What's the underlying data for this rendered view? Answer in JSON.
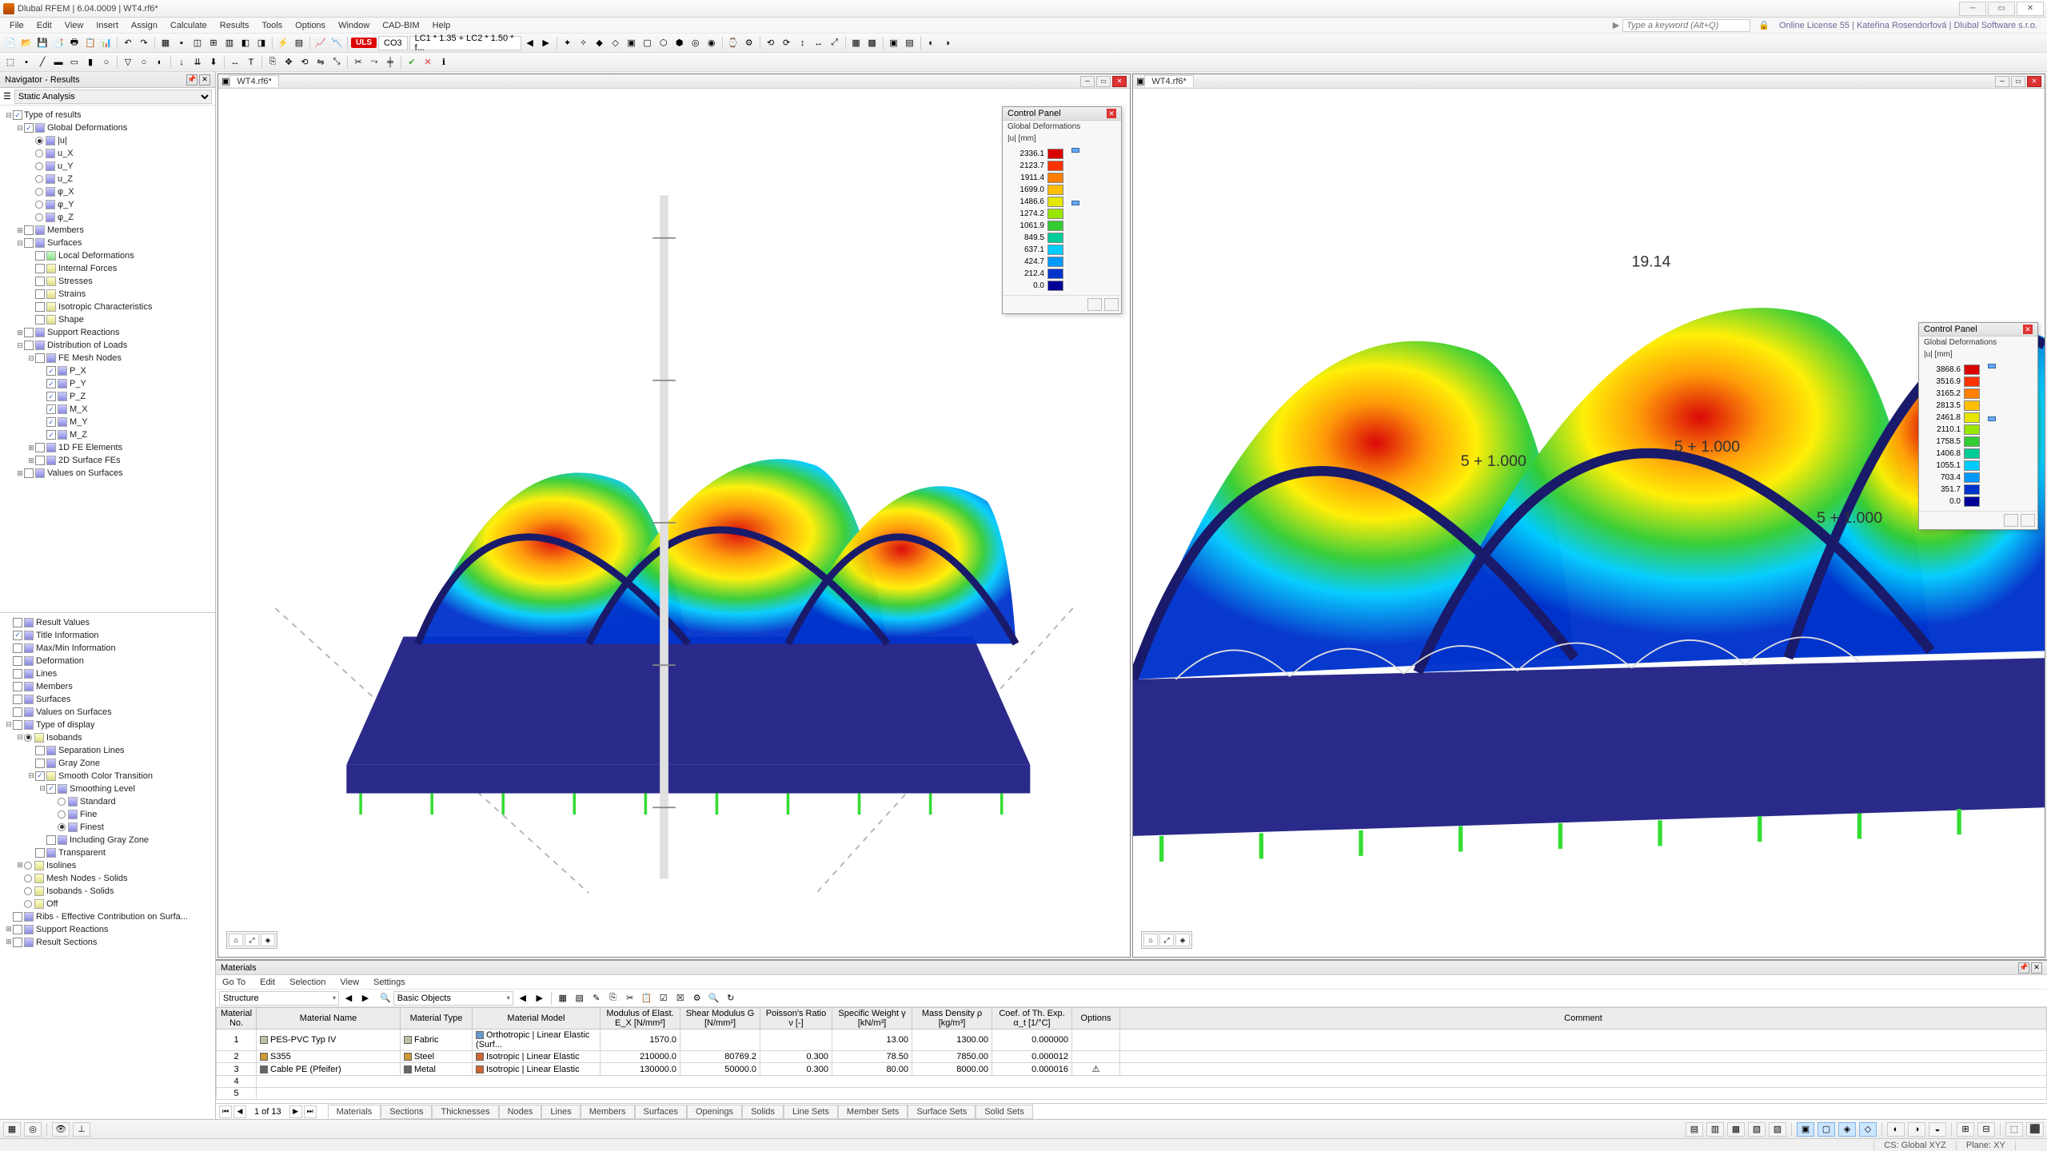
{
  "app": {
    "title": "Dlubal RFEM | 6.04.0009 | WT4.rf6*",
    "keyword_placeholder": "Type a keyword (Alt+Q)",
    "license": "Online License 55 | Kateřina Rosendorfová | Dlubal Software s.r.o."
  },
  "menu": [
    "File",
    "Edit",
    "View",
    "Insert",
    "Assign",
    "Calculate",
    "Results",
    "Tools",
    "Options",
    "Window",
    "CAD-BIM",
    "Help"
  ],
  "loadcase": {
    "badge": "ULS",
    "combo": "CO3",
    "desc": "LC1 * 1.35 + LC2 * 1.50 * f..."
  },
  "navigator": {
    "title": "Navigator - Results",
    "mode": "Static Analysis",
    "top": [
      {
        "lvl": 0,
        "toggle": "-",
        "cb": true,
        "label": "Type of results"
      },
      {
        "lvl": 1,
        "toggle": "-",
        "cb": true,
        "ico": "b",
        "label": "Global Deformations"
      },
      {
        "lvl": 2,
        "radio": true,
        "on": true,
        "ico": "b",
        "label": "|u|"
      },
      {
        "lvl": 2,
        "radio": true,
        "ico": "b",
        "label": "u_X"
      },
      {
        "lvl": 2,
        "radio": true,
        "ico": "b",
        "label": "u_Y"
      },
      {
        "lvl": 2,
        "radio": true,
        "ico": "b",
        "label": "u_Z"
      },
      {
        "lvl": 2,
        "radio": true,
        "ico": "b",
        "label": "φ_X"
      },
      {
        "lvl": 2,
        "radio": true,
        "ico": "b",
        "label": "φ_Y"
      },
      {
        "lvl": 2,
        "radio": true,
        "ico": "b",
        "label": "φ_Z"
      },
      {
        "lvl": 1,
        "toggle": "+",
        "cb": false,
        "ico": "b",
        "label": "Members"
      },
      {
        "lvl": 1,
        "toggle": "-",
        "cb": false,
        "ico": "b",
        "label": "Surfaces"
      },
      {
        "lvl": 2,
        "cb": false,
        "ico": "g",
        "label": "Local Deformations"
      },
      {
        "lvl": 2,
        "cb": false,
        "ico": "y",
        "label": "Internal Forces"
      },
      {
        "lvl": 2,
        "cb": false,
        "ico": "y",
        "label": "Stresses"
      },
      {
        "lvl": 2,
        "cb": false,
        "ico": "y",
        "label": "Strains"
      },
      {
        "lvl": 2,
        "cb": false,
        "ico": "y",
        "label": "Isotropic Characteristics"
      },
      {
        "lvl": 2,
        "cb": false,
        "ico": "y",
        "label": "Shape"
      },
      {
        "lvl": 1,
        "toggle": "+",
        "cb": false,
        "ico": "b",
        "label": "Support Reactions"
      },
      {
        "lvl": 1,
        "toggle": "-",
        "cb": false,
        "ico": "b",
        "label": "Distribution of Loads"
      },
      {
        "lvl": 2,
        "toggle": "-",
        "cb": false,
        "ico": "b",
        "label": "FE Mesh Nodes"
      },
      {
        "lvl": 3,
        "cb": true,
        "ico": "b",
        "label": "P_X"
      },
      {
        "lvl": 3,
        "cb": true,
        "ico": "b",
        "label": "P_Y"
      },
      {
        "lvl": 3,
        "cb": true,
        "ico": "b",
        "label": "P_Z"
      },
      {
        "lvl": 3,
        "cb": true,
        "ico": "b",
        "label": "M_X"
      },
      {
        "lvl": 3,
        "cb": true,
        "ico": "b",
        "label": "M_Y"
      },
      {
        "lvl": 3,
        "cb": true,
        "ico": "b",
        "label": "M_Z"
      },
      {
        "lvl": 2,
        "toggle": "+",
        "cb": false,
        "ico": "b",
        "label": "1D FE Elements"
      },
      {
        "lvl": 2,
        "toggle": "+",
        "cb": false,
        "ico": "b",
        "label": "2D Surface FEs"
      },
      {
        "lvl": 1,
        "toggle": "+",
        "cb": false,
        "ico": "b",
        "label": "Values on Surfaces"
      }
    ],
    "bottom": [
      {
        "lvl": 0,
        "cb": false,
        "ico": "b",
        "label": "Result Values"
      },
      {
        "lvl": 0,
        "cb": true,
        "ico": "b",
        "label": "Title Information"
      },
      {
        "lvl": 0,
        "cb": false,
        "ico": "b",
        "label": "Max/Min Information"
      },
      {
        "lvl": 0,
        "cb": false,
        "ico": "b",
        "label": "Deformation"
      },
      {
        "lvl": 0,
        "cb": false,
        "ico": "b",
        "label": "Lines"
      },
      {
        "lvl": 0,
        "cb": false,
        "ico": "b",
        "label": "Members"
      },
      {
        "lvl": 0,
        "cb": false,
        "ico": "b",
        "label": "Surfaces"
      },
      {
        "lvl": 0,
        "cb": false,
        "ico": "b",
        "label": "Values on Surfaces"
      },
      {
        "lvl": 0,
        "toggle": "-",
        "cb": false,
        "ico": "b",
        "label": "Type of display"
      },
      {
        "lvl": 1,
        "toggle": "-",
        "radio": true,
        "on": true,
        "ico": "y",
        "label": "Isobands"
      },
      {
        "lvl": 2,
        "cb": false,
        "ico": "b",
        "label": "Separation Lines"
      },
      {
        "lvl": 2,
        "cb": false,
        "ico": "b",
        "label": "Gray Zone"
      },
      {
        "lvl": 2,
        "toggle": "-",
        "cb": true,
        "ico": "y",
        "label": "Smooth Color Transition"
      },
      {
        "lvl": 3,
        "toggle": "-",
        "cb": true,
        "ico": "b",
        "label": "Smoothing Level"
      },
      {
        "lvl": 4,
        "radio": true,
        "ico": "b",
        "label": "Standard"
      },
      {
        "lvl": 4,
        "radio": true,
        "ico": "b",
        "label": "Fine"
      },
      {
        "lvl": 4,
        "radio": true,
        "on": true,
        "ico": "b",
        "label": "Finest"
      },
      {
        "lvl": 3,
        "cb": false,
        "ico": "b",
        "label": "Including Gray Zone"
      },
      {
        "lvl": 2,
        "cb": false,
        "ico": "b",
        "label": "Transparent"
      },
      {
        "lvl": 1,
        "toggle": "+",
        "radio": true,
        "ico": "y",
        "label": "Isolines"
      },
      {
        "lvl": 1,
        "radio": true,
        "ico": "y",
        "label": "Mesh Nodes - Solids"
      },
      {
        "lvl": 1,
        "radio": true,
        "ico": "y",
        "label": "Isobands - Solids"
      },
      {
        "lvl": 1,
        "radio": true,
        "ico": "y",
        "label": "Off"
      },
      {
        "lvl": 0,
        "cb": false,
        "ico": "b",
        "label": "Ribs - Effective Contribution on Surfa..."
      },
      {
        "lvl": 0,
        "toggle": "+",
        "cb": false,
        "ico": "b",
        "label": "Support Reactions"
      },
      {
        "lvl": 0,
        "toggle": "+",
        "cb": false,
        "ico": "b",
        "label": "Result Sections"
      }
    ]
  },
  "viewport": {
    "tab": "WT4.rf6*",
    "cp1": {
      "title": "Control Panel",
      "sub1": "Global Deformations",
      "sub2": "|u| [mm]",
      "scale": [
        {
          "v": "2336.1",
          "c": "#d90000"
        },
        {
          "v": "2123.7",
          "c": "#ff3300"
        },
        {
          "v": "1911.4",
          "c": "#ff8000"
        },
        {
          "v": "1699.0",
          "c": "#ffbf00"
        },
        {
          "v": "1486.6",
          "c": "#e6e600"
        },
        {
          "v": "1274.2",
          "c": "#99e600"
        },
        {
          "v": "1061.9",
          "c": "#33cc33"
        },
        {
          "v": "849.5",
          "c": "#00cc99"
        },
        {
          "v": "637.1",
          "c": "#00ccff"
        },
        {
          "v": "424.7",
          "c": "#0099ff"
        },
        {
          "v": "212.4",
          "c": "#0033cc"
        },
        {
          "v": "0.0",
          "c": "#000099"
        }
      ]
    },
    "cp2": {
      "title": "Control Panel",
      "sub1": "Global Deformations",
      "sub2": "|u| [mm]",
      "scale": [
        {
          "v": "3868.6",
          "c": "#d90000"
        },
        {
          "v": "3516.9",
          "c": "#ff3300"
        },
        {
          "v": "3165.2",
          "c": "#ff8000"
        },
        {
          "v": "2813.5",
          "c": "#ffbf00"
        },
        {
          "v": "2461.8",
          "c": "#e6e600"
        },
        {
          "v": "2110.1",
          "c": "#99e600"
        },
        {
          "v": "1758.5",
          "c": "#33cc33"
        },
        {
          "v": "1406.8",
          "c": "#00cc99"
        },
        {
          "v": "1055.1",
          "c": "#00ccff"
        },
        {
          "v": "703.4",
          "c": "#0099ff"
        },
        {
          "v": "351.7",
          "c": "#0033cc"
        },
        {
          "v": "0.0",
          "c": "#000099"
        }
      ]
    }
  },
  "materials": {
    "title": "Materials",
    "menu": [
      "Go To",
      "Edit",
      "Selection",
      "View",
      "Settings"
    ],
    "dd1": "Structure",
    "dd2": "Basic Objects",
    "headers": {
      "no": "Material No.",
      "name": "Material Name",
      "type": "Material Type",
      "model": "Material Model",
      "e": "Modulus of Elast. E_X [N/mm²]",
      "g": "Shear Modulus G [N/mm²]",
      "v": "Poisson's Ratio ν [-]",
      "w": "Specific Weight γ [kN/m³]",
      "d": "Mass Density ρ [kg/m³]",
      "a": "Coef. of Th. Exp. α_t [1/°C]",
      "opt": "Options",
      "comment": "Comment"
    },
    "rows": [
      {
        "no": "1",
        "name": "PES-PVC Typ IV",
        "sw": "#c0c0a0",
        "type": "Fabric",
        "msw": "#6699cc",
        "model": "Orthotropic | Linear Elastic (Surf...",
        "e": "1570.0",
        "g": "",
        "v": "",
        "w": "13.00",
        "d": "1300.00",
        "a": "0.000000"
      },
      {
        "no": "2",
        "name": "S355",
        "sw": "#cc9933",
        "type": "Steel",
        "msw": "#cc6633",
        "model": "Isotropic | Linear Elastic",
        "e": "210000.0",
        "g": "80769.2",
        "v": "0.300",
        "w": "78.50",
        "d": "7850.00",
        "a": "0.000012"
      },
      {
        "no": "3",
        "name": "Cable PE (Pfeifer)",
        "sw": "#666666",
        "type": "Metal",
        "msw": "#cc6633",
        "model": "Isotropic | Linear Elastic",
        "e": "130000.0",
        "g": "50000.0",
        "v": "0.300",
        "w": "80.00",
        "d": "8000.00",
        "a": "0.000016"
      }
    ],
    "page": "1 of 13",
    "tabs": [
      "Materials",
      "Sections",
      "Thicknesses",
      "Nodes",
      "Lines",
      "Members",
      "Surfaces",
      "Openings",
      "Solids",
      "Line Sets",
      "Member Sets",
      "Surface Sets",
      "Solid Sets"
    ]
  },
  "status": {
    "cs": "CS: Global XYZ",
    "plane": "Plane: XY"
  }
}
